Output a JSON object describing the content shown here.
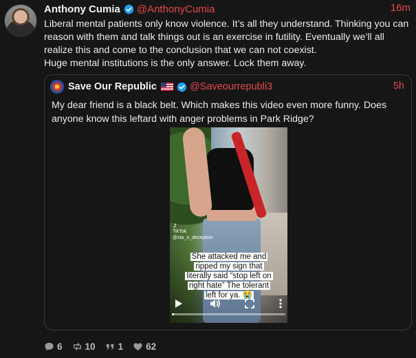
{
  "post": {
    "display_name": "Anthony Cumia",
    "handle": "@AnthonyCumia",
    "time": "16m",
    "text_lines": [
      "Liberal mental patients only know violence. It’s all they understand. Thinking you can reason with them and talk things out is an exercise in futility. Eventually we’ll all realize this and come to the conclusion that we can not coexist.",
      "Huge mental institutions is the only answer. Lock them away."
    ],
    "avatar_icon": "profile-photo"
  },
  "quote": {
    "display_name": "Save Our Republic",
    "flag_icon": "us-flag-icon",
    "handle": "@Saveourrepubli3",
    "time": "5h",
    "text": "My dear friend is a black belt. Which makes this video even more funny.  Does anyone know this leftard with anger problems in Park Ridge?",
    "video": {
      "watermark": "TikTok",
      "watermark_user": "@sta_o_deception",
      "caption": "She attacked me and ripped my sign that literally said “stop left on right hate” The tolerant left for ya. 😭",
      "progress": 0.02
    }
  },
  "actions": {
    "replies": "6",
    "reposts": "10",
    "quotes": "1",
    "likes": "62"
  },
  "colors": {
    "accent": "#e5484d",
    "verified": "#1d9bf0",
    "background": "#161616",
    "muted": "#9a9a9a"
  }
}
